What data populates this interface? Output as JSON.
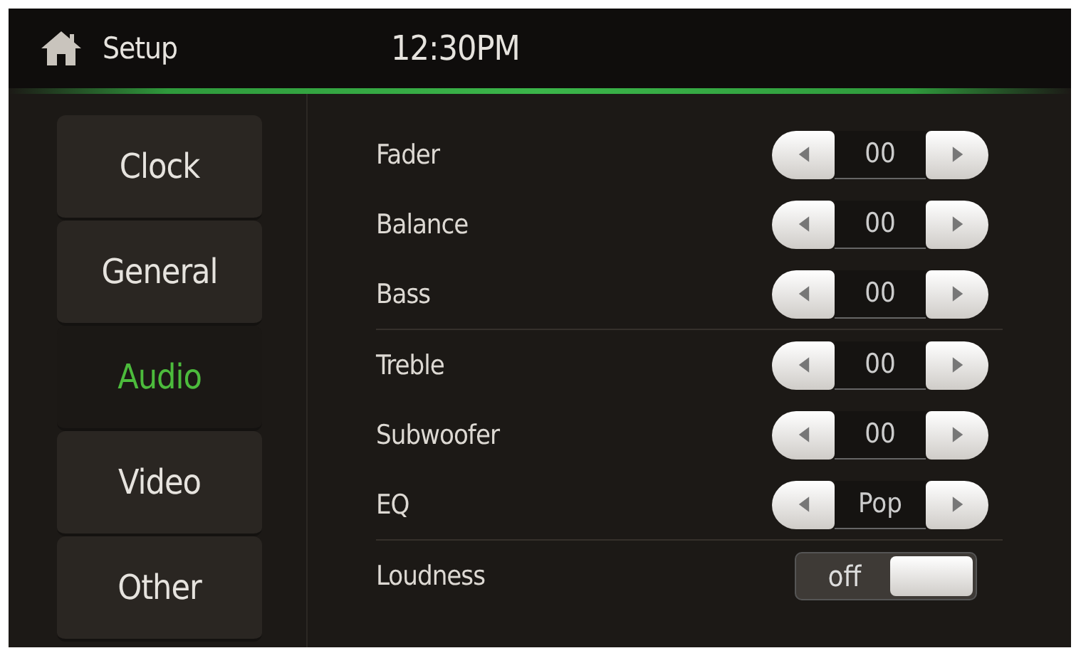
{
  "header": {
    "title": "Setup",
    "time": "12:30PM"
  },
  "sidebar": {
    "items": [
      {
        "label": "Clock",
        "selected": false
      },
      {
        "label": "General",
        "selected": false
      },
      {
        "label": "Audio",
        "selected": true
      },
      {
        "label": "Video",
        "selected": false
      },
      {
        "label": "Other",
        "selected": false
      }
    ]
  },
  "settings": [
    {
      "kind": "stepper",
      "label": "Fader",
      "value": "00"
    },
    {
      "kind": "stepper",
      "label": "Balance",
      "value": "00"
    },
    {
      "kind": "stepper",
      "label": "Bass",
      "value": "00"
    },
    {
      "kind": "stepper",
      "label": "Treble",
      "value": "00"
    },
    {
      "kind": "stepper",
      "label": "Subwoofer",
      "value": "00"
    },
    {
      "kind": "stepper",
      "label": "EQ",
      "value": "Pop"
    },
    {
      "kind": "toggle",
      "label": "Loudness",
      "value": "off",
      "on": false
    }
  ]
}
